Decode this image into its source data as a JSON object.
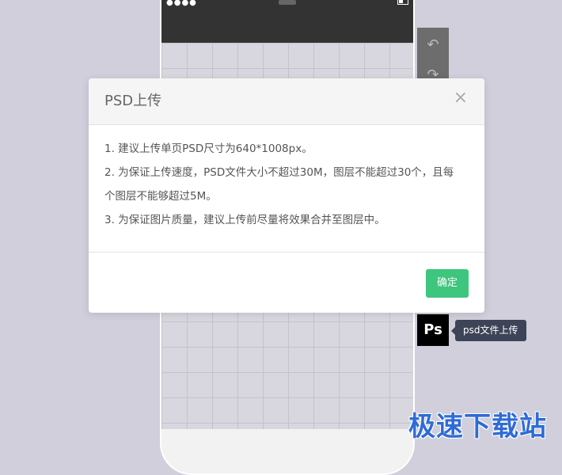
{
  "phone": {
    "signal_icon": "signal-dots-icon",
    "battery_icon": "battery-icon"
  },
  "side_toolbar": {
    "undo_icon": "undo-icon",
    "redo_icon": "redo-icon",
    "undo_glyph": "↶",
    "redo_glyph": "↷"
  },
  "ps_upload": {
    "label": "Ps",
    "tooltip": "psd文件上传"
  },
  "modal": {
    "title": "PSD上传",
    "close_glyph": "×",
    "lines": [
      "1. 建议上传单页PSD尺寸为640*1008px。",
      "2. 为保证上传速度，PSD文件大小不超过30M，图层不能超过30个，且每",
      "个图层不能够超过5M。",
      "3. 为保证图片质量，建议上传前尽量将效果合并至图层中。"
    ],
    "confirm_label": "确定"
  },
  "watermark": "极速下载站",
  "colors": {
    "background": "#d0cfdb",
    "confirm": "#3ec57e",
    "tooltip": "#3e4457",
    "status_bar": "#333333",
    "watermark": "#2f6bd6"
  }
}
